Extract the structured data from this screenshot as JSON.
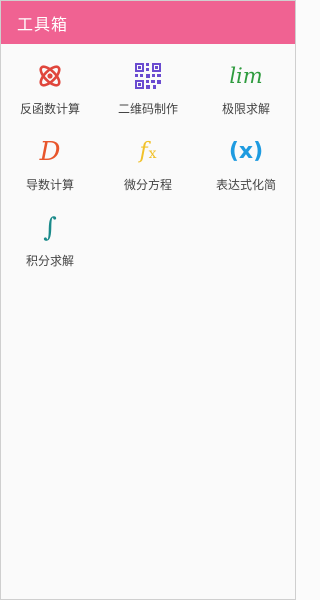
{
  "app": {
    "title": "工具箱"
  },
  "colors": {
    "appbar": "#f06292",
    "background": "#fafafa",
    "label": "#444444"
  },
  "tools": [
    {
      "label": "反函数计算",
      "icon": "atom-icon"
    },
    {
      "label": "二维码制作",
      "icon": "qr-code-icon"
    },
    {
      "label": "极限求解",
      "icon": "lim-icon",
      "glyph": "lim"
    },
    {
      "label": "导数计算",
      "icon": "derivative-icon",
      "glyph": "D"
    },
    {
      "label": "微分方程",
      "icon": "fx-icon",
      "glyph": "f",
      "glyph_sub": "x"
    },
    {
      "label": "表达式化简",
      "icon": "parenthesis-x-icon",
      "glyph": "(x)"
    },
    {
      "label": "积分求解",
      "icon": "integral-icon",
      "glyph": "∫"
    }
  ]
}
